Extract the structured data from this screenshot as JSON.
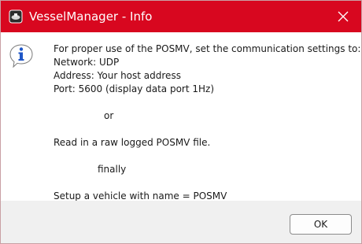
{
  "window": {
    "title": "VesselManager - Info"
  },
  "message": {
    "lines": [
      "For proper use of the POSMV, set the communication settings to:",
      "Network: UDP",
      "Address: Your host address",
      "Port: 5600 (display data port 1Hz)",
      "",
      "or",
      "",
      "Read in a raw logged POSMV file.",
      "",
      "finally",
      "",
      "Setup a vehicle with name = POSMV"
    ]
  },
  "buttons": {
    "ok_label": "OK"
  },
  "icons": {
    "app": "vessel-manager-app-icon",
    "info": "info-icon",
    "close": "close-icon"
  },
  "colors": {
    "titlebar": "#d8071f",
    "title_text": "#ffffff",
    "info_blue": "#1f57c7"
  }
}
